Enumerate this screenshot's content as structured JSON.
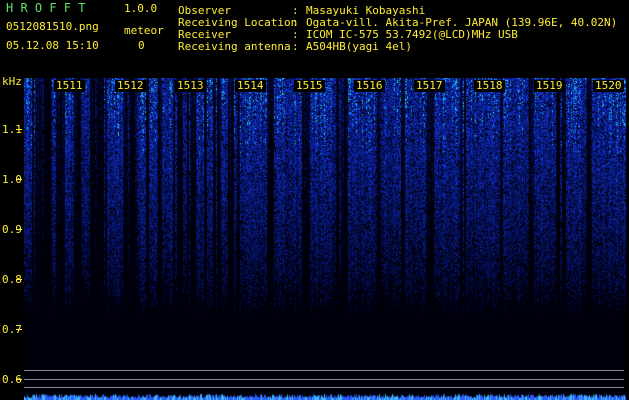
{
  "app": {
    "name": "H R O F F T",
    "version": "1.0.0"
  },
  "file": {
    "name": "0512081510.png",
    "datetime": "05.12.08 15:10"
  },
  "meteor": {
    "label": "meteor",
    "count": "0"
  },
  "info": [
    {
      "label": "Observer",
      "sep": ":",
      "value": "Masayuki Kobayashi"
    },
    {
      "label": "Receiving Location",
      "sep": ":",
      "value": "Ogata-vill. Akita-Pref. JAPAN (139.96E, 40.02N)"
    },
    {
      "label": "Receiver",
      "sep": ":",
      "value": "ICOM IC-575 53.7492(@LCD)MHz USB"
    },
    {
      "label": "Receiving antenna",
      "sep": ":",
      "value": "A504HB(yagi 4el)"
    }
  ],
  "axis": {
    "unit": "kHz",
    "ticks": [
      "1.1",
      "1.0",
      "0.9",
      "0.8",
      "0.7",
      "0.6"
    ]
  },
  "time_marks": [
    "1511",
    "1512",
    "1513",
    "1514",
    "1515",
    "1516",
    "1517",
    "1518",
    "1519",
    "1520"
  ],
  "colors": {
    "label": "#ffee33",
    "header": "#5fe06a",
    "signal": "#1e3cff",
    "bright": "#38e8ff"
  }
}
